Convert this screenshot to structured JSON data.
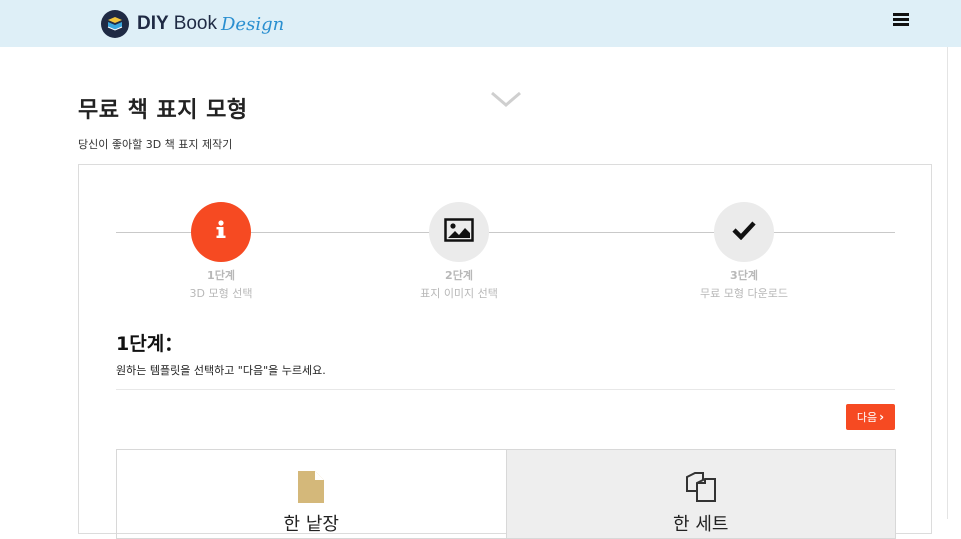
{
  "header": {
    "logo_diy": "DIY",
    "logo_book": "Book",
    "logo_design": "Design"
  },
  "page": {
    "title": "무료 책 표지 모형",
    "subtitle": "당신이 좋아할 3D 책 표지 제작기"
  },
  "steps": [
    {
      "number": "1단계",
      "label": "3D 모형 선택",
      "icon": "info-icon",
      "active": true
    },
    {
      "number": "2단계",
      "label": "표지 이미지 선택",
      "icon": "image-icon",
      "active": false
    },
    {
      "number": "3단계",
      "label": "무료 모형 다운로드",
      "icon": "check-icon",
      "active": false
    }
  ],
  "section": {
    "title": "1단계：",
    "instruction": "원하는 템플릿을 선택하고 \"다음\"을 누르세요."
  },
  "next_button": {
    "label": "다음"
  },
  "tiles": [
    {
      "label": "한 낱장",
      "icon": "single-page-icon"
    },
    {
      "label": "한 세트",
      "icon": "multi-page-icon"
    }
  ],
  "colors": {
    "header_bg": "#deeff7",
    "accent": "#f64a22",
    "logo_dark": "#1f2a44",
    "logo_blue": "#2a8fd0",
    "page_icon_fill": "#d4b87a"
  }
}
